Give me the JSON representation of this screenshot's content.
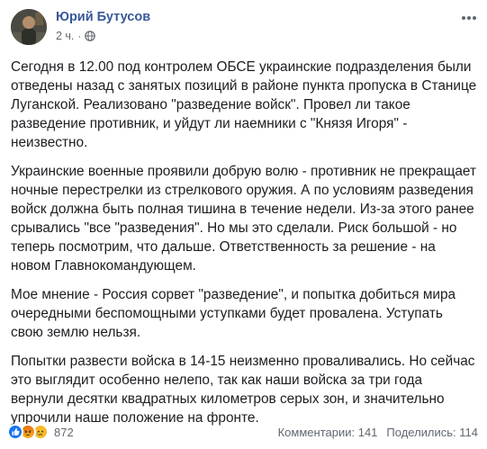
{
  "post": {
    "author": "Юрий Бутусов",
    "time": "2 ч.",
    "separator": "·",
    "privacy_icon": "globe-icon",
    "menu_icon": "more-horizontal-icon",
    "paragraphs": [
      "Сегодня в 12.00 под контролем ОБСЕ украинские подразделения были отведены назад с занятых позиций в районе пункта пропуска в Станице Луганской. Реализовано \"разведение войск\". Провел ли такое разведение противник, и уйдут ли наемники с \"Князя Игоря\" - неизвестно.",
      "Украинские военные проявили добрую волю - противник не прекращает ночные перестрелки из стрелкового оружия. А по условиям разведения войск должна быть полная тишина в течение недели. Из-за этого ранее срывались \"все \"разведения\". Но мы это сделали. Риск большой - но теперь посмотрим, что дальше. Ответственность за решение - на новом Главнокомандующем.",
      "Мое мнение - Россия сорвет \"разведение\", и попытка добиться мира очередными беспомощными уступками будет провалена. Уступать свою землю нельзя.",
      "Попытки развести войска в 14-15 неизменно проваливались. Но сейчас это выглядит особенно нелепо, так как наши войска за три года вернули десятки квадратных километров серых зон, и значительно упрочили наше положение на фронте."
    ]
  },
  "footer": {
    "reaction_icons": [
      "like-icon",
      "angry-icon",
      "sad-icon"
    ],
    "reaction_count": "872",
    "comments": "Комментарии: 141",
    "shares": "Поделились: 114"
  },
  "colors": {
    "author": "#385898",
    "meta": "#606770",
    "text": "#1c1e21",
    "like": "#1877f2",
    "sad": "#f7b928"
  }
}
